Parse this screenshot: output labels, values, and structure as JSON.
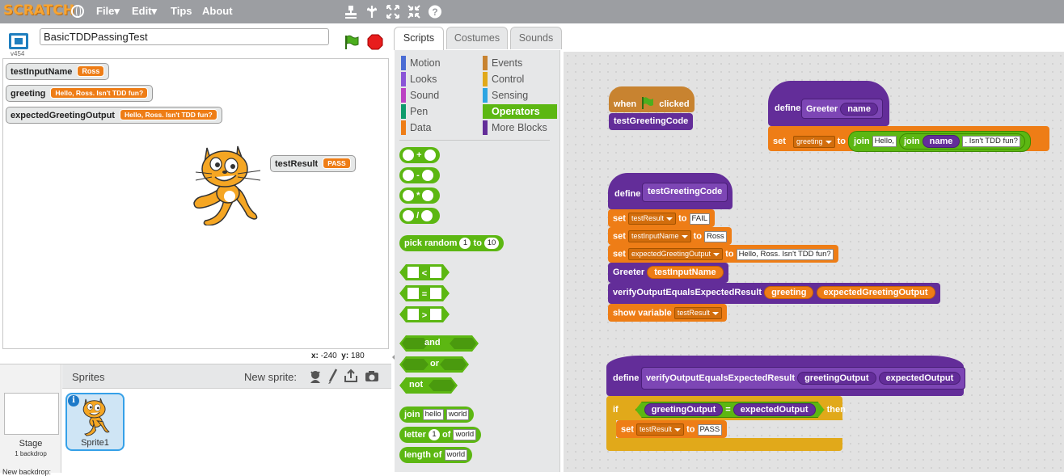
{
  "menubar": {
    "logo": "SCRATCH",
    "file": "File▾",
    "edit": "Edit▾",
    "tips": "Tips",
    "about": "About",
    "colors": {
      "bar": "#9c9ea2",
      "logo": "#f7a431"
    }
  },
  "project": {
    "title": "BasicTDDPassingTest",
    "version": "v454"
  },
  "stage": {
    "monitors": [
      {
        "name": "testInputName",
        "value": "Ross"
      },
      {
        "name": "greeting",
        "value": "Hello, Ross. Isn't TDD fun?"
      },
      {
        "name": "expectedGreetingOutput",
        "value": "Hello, Ross. Isn't TDD fun?"
      },
      {
        "name": "testResult",
        "value": "PASS"
      }
    ],
    "x_label": "x:",
    "x_value": "-240",
    "y_label": "y:",
    "y_value": "180"
  },
  "sprites_pane": {
    "header": "Sprites",
    "new_sprite": "New sprite:",
    "stage_label": "Stage",
    "stage_sub": "1 backdrop",
    "new_backdrop": "New backdrop:",
    "sprite_name": "Sprite1"
  },
  "tabs": [
    "Scripts",
    "Costumes",
    "Sounds"
  ],
  "palette": {
    "categories": [
      {
        "label": "Motion",
        "color": "#4a6cd4"
      },
      {
        "label": "Looks",
        "color": "#8a55d7"
      },
      {
        "label": "Sound",
        "color": "#bb42c3"
      },
      {
        "label": "Pen",
        "color": "#0e9a6c"
      },
      {
        "label": "Data",
        "color": "#ee7d16"
      },
      {
        "label": "Events",
        "color": "#c88330"
      },
      {
        "label": "Control",
        "color": "#e1a91a"
      },
      {
        "label": "Sensing",
        "color": "#2ca5e2"
      },
      {
        "label": "Operators",
        "color": "#5cb712"
      },
      {
        "label": "More Blocks",
        "color": "#632d99"
      }
    ],
    "ops": [
      "+",
      "-",
      "*",
      "/"
    ],
    "pick_random": {
      "label": "pick random",
      "to": "to",
      "a": "1",
      "b": "10"
    },
    "compare": [
      "<",
      "=",
      ">"
    ],
    "logic": [
      "and",
      "or",
      "not"
    ],
    "join": {
      "label": "join",
      "a": "hello",
      "b": "world"
    },
    "letter": {
      "label": "letter",
      "n": "1",
      "of": "of",
      "w": "world"
    },
    "length": {
      "label": "length of",
      "w": "world"
    }
  },
  "scripts": {
    "when_clicked": {
      "when": "when",
      "clicked": "clicked",
      "call": "testGreetingCode"
    },
    "define_greeter": {
      "define": "define",
      "name": "Greeter",
      "param": "name",
      "set": "set",
      "var": "greeting",
      "to": "to",
      "join": "join",
      "hello": "Hello,",
      "join2": "join",
      "pname": "name",
      "tail": ". Isn't TDD fun?"
    },
    "define_test": {
      "define": "define",
      "name": "testGreetingCode",
      "set1": {
        "set": "set",
        "var": "testResult",
        "to": "to",
        "val": "FAIL"
      },
      "set2": {
        "set": "set",
        "var": "testInputName",
        "to": "to",
        "val": "Ross"
      },
      "set3": {
        "set": "set",
        "var": "expectedGreetingOutput",
        "to": "to",
        "val": "Hello, Ross. Isn't TDD fun?"
      },
      "greeter": {
        "label": "Greeter",
        "arg": "testInputName"
      },
      "verify": {
        "label": "verifyOutputEqualsExpectedResult",
        "a": "greeting",
        "b": "expectedGreetingOutput"
      },
      "show": {
        "label": "show variable",
        "var": "testResult"
      }
    },
    "define_verify": {
      "define": "define",
      "name": "verifyOutputEqualsExpectedResult",
      "p1": "greetingOutput",
      "p2": "expectedOutput",
      "if": "if",
      "a": "greetingOutput",
      "eq": "=",
      "b": "expectedOutput",
      "then": "then",
      "set": "set",
      "var": "testResult",
      "to": "to",
      "val": "PASS"
    }
  }
}
